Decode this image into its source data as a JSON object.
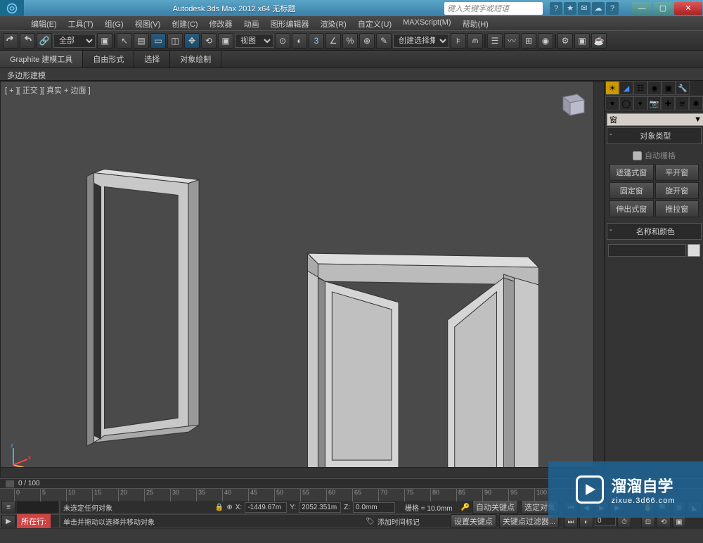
{
  "title": "Autodesk 3ds Max  2012 x64     无标题",
  "search_placeholder": "键入关键字或短语",
  "menus": [
    "编辑(E)",
    "工具(T)",
    "组(G)",
    "视图(V)",
    "创建(C)",
    "修改器",
    "动画",
    "图形编辑器",
    "渲染(R)",
    "自定义(U)",
    "MAXScript(M)",
    "帮助(H)"
  ],
  "toolbar": {
    "filter": "全部",
    "view_label": "视图",
    "selset_label": "创建选择集"
  },
  "ribbon": {
    "tabs": [
      "Graphite 建模工具",
      "自由形式",
      "选择",
      "对象绘制"
    ],
    "sub": "多边形建模"
  },
  "viewport_label": "[ + ][ 正交 ][ 真实 + 边面 ]",
  "panel": {
    "dropdown": "窗",
    "rollout1": "对象类型",
    "autogrid": "自动栅格",
    "buttons": [
      "遮篷式窗",
      "平开窗",
      "固定窗",
      "旋开窗",
      "伸出式窗",
      "推拉窗"
    ],
    "rollout2": "名称和颜色"
  },
  "time": {
    "range": "0 / 100"
  },
  "ticks": [
    0,
    5,
    10,
    15,
    20,
    25,
    30,
    35,
    40,
    45,
    50,
    55,
    60,
    65,
    70,
    75,
    80,
    85,
    90,
    95,
    100
  ],
  "status": {
    "loc": "所在行:",
    "sel": "未选定任何对象",
    "hint": "单击并拖动以选择并移动对象",
    "x": "-1449.67m",
    "y": "2052.351m",
    "z": "0.0mm",
    "grid": "栅格 = 10.0mm",
    "autokey": "自动关键点",
    "selobj": "选定对象",
    "setkey": "设置关键点",
    "keyfilter": "关键点过滤器...",
    "addtime": "添加时间标记"
  },
  "watermark": {
    "main": "溜溜自学",
    "sub": "zixue.3d66.com"
  }
}
